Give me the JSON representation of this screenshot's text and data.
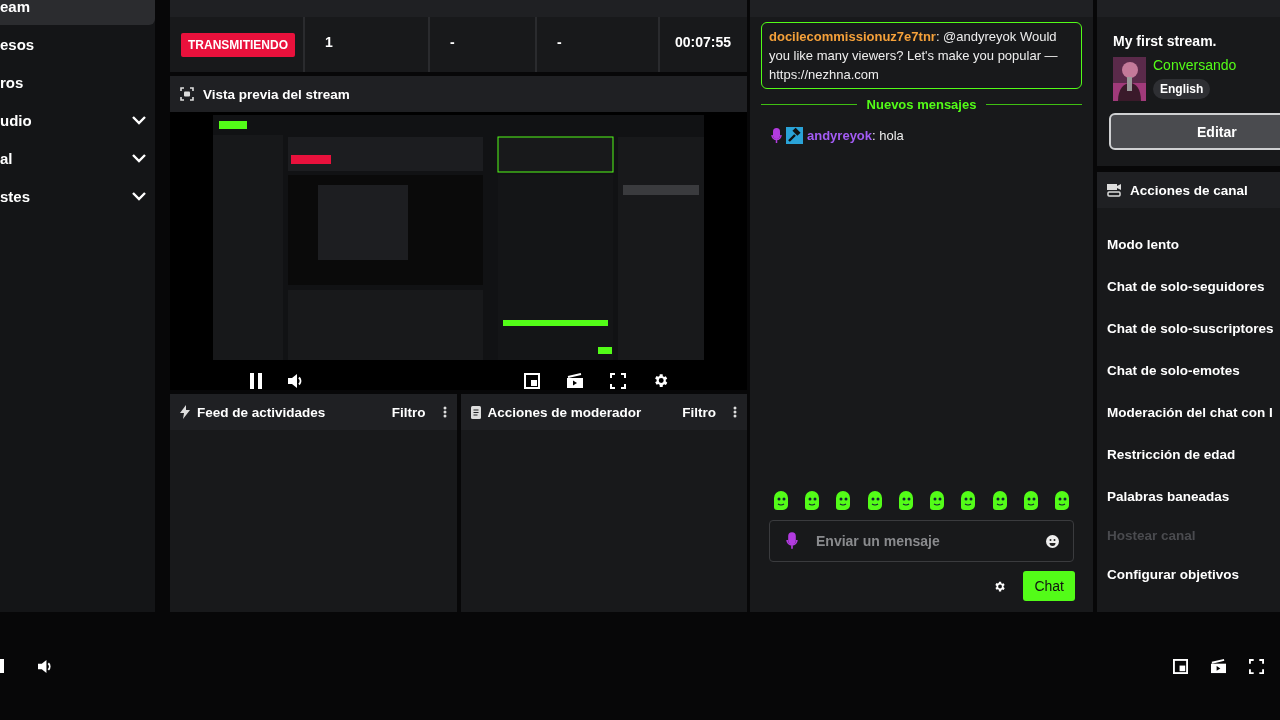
{
  "sidebar": {
    "items": [
      {
        "label": "eam",
        "selected": true,
        "expandable": false
      },
      {
        "label": "esos",
        "selected": false,
        "expandable": false
      },
      {
        "label": "ros",
        "selected": false,
        "expandable": false
      },
      {
        "label": "udio",
        "selected": false,
        "expandable": true
      },
      {
        "label": "al",
        "selected": false,
        "expandable": true
      },
      {
        "label": "stes",
        "selected": false,
        "expandable": true
      }
    ]
  },
  "session": {
    "status": "TRANSMITIENDO",
    "stats": [
      "1",
      "-",
      "-",
      "00:07:55"
    ]
  },
  "preview": {
    "title": "Vista previa del stream"
  },
  "panels": [
    {
      "title": "Feed de actividades",
      "filter": "Filtro",
      "kind": "activity"
    },
    {
      "title": "Acciones de moderador",
      "filter": "Filtro",
      "kind": "moderator"
    }
  ],
  "chat": {
    "items": [
      {
        "kind": "highlight",
        "user": "docilecommissionuz7e7tnr",
        "color": "#f5a13a",
        "text": ": @andyreyok Would you like many viewers? Let's make you popular — https://nezhna.com"
      },
      {
        "kind": "divider",
        "text": "Nuevos mensajes"
      },
      {
        "kind": "moderator",
        "user": "andyreyok",
        "color": "#a35cf5",
        "text": ": hola"
      }
    ],
    "placeholder": "Enviar un mensaje",
    "send": "Chat"
  },
  "stream_info": {
    "title": "My first stream.",
    "category": "Conversando",
    "language": "English",
    "edit": "Editar"
  },
  "channel_actions": {
    "title": "Acciones de canal",
    "items": [
      {
        "label": "Modo lento",
        "disabled": false
      },
      {
        "label": "Chat de solo-seguidores",
        "disabled": false
      },
      {
        "label": "Chat de solo-suscriptores",
        "disabled": false
      },
      {
        "label": "Chat de solo-emotes",
        "disabled": false
      },
      {
        "label": "Moderación del chat con I",
        "disabled": false
      },
      {
        "label": "Restricción de edad",
        "disabled": false
      },
      {
        "label": "Palabras baneadas",
        "disabled": false
      },
      {
        "label": "Hostear canal",
        "disabled": true
      },
      {
        "label": "Configurar objetivos",
        "disabled": false
      }
    ]
  }
}
